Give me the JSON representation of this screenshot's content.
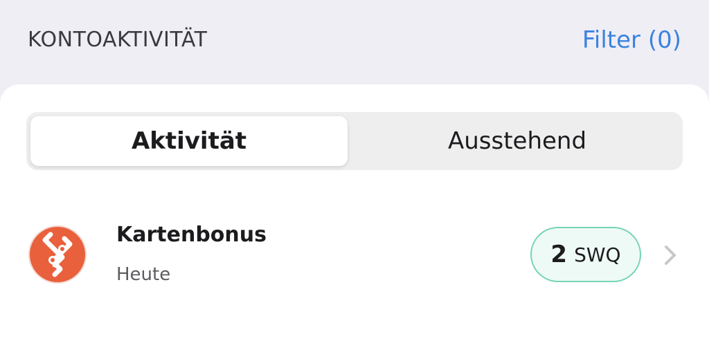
{
  "header": {
    "title": "KONTOAKTIVITÄT",
    "filter_label": "Filter (0)"
  },
  "segments": {
    "active_label": "Aktivität",
    "inactive_label": "Ausstehend"
  },
  "activity": {
    "items": [
      {
        "title": "Kartenbonus",
        "date": "Heute",
        "amount": "2",
        "currency": "SWQ",
        "icon": "swissquote-logo-icon"
      }
    ]
  },
  "colors": {
    "accent": "#3b82e0",
    "brand_orange": "#e8603c",
    "amount_border": "#74d3b5",
    "amount_bg": "#eefaf6"
  }
}
